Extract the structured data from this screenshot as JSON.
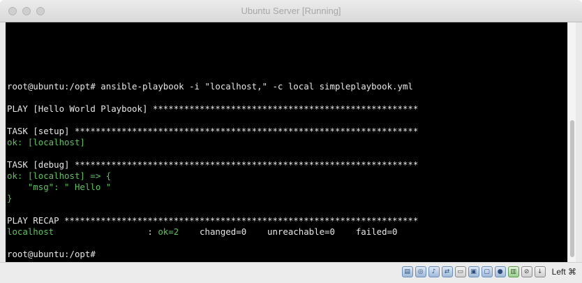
{
  "window": {
    "title": "Ubuntu Server [Running]"
  },
  "terminal": {
    "lines": [
      {
        "segments": [
          {
            "text": "root@ubuntu:/opt# ansible-playbook -i \"localhost,\" -c local simpleplaybook.yml",
            "color": "white"
          }
        ]
      },
      {
        "segments": [
          {
            "text": "",
            "color": "white"
          }
        ]
      },
      {
        "segments": [
          {
            "text": "PLAY [Hello World Playbook] ***************************************************",
            "color": "white"
          }
        ]
      },
      {
        "segments": [
          {
            "text": "",
            "color": "white"
          }
        ]
      },
      {
        "segments": [
          {
            "text": "TASK [setup] ******************************************************************",
            "color": "white"
          }
        ]
      },
      {
        "segments": [
          {
            "text": "ok: [localhost]",
            "color": "green"
          }
        ]
      },
      {
        "segments": [
          {
            "text": "",
            "color": "white"
          }
        ]
      },
      {
        "segments": [
          {
            "text": "TASK [debug] ******************************************************************",
            "color": "white"
          }
        ]
      },
      {
        "segments": [
          {
            "text": "ok: [localhost] => {",
            "color": "green"
          }
        ]
      },
      {
        "segments": [
          {
            "text": "    \"msg\": \" Hello \"",
            "color": "green"
          }
        ]
      },
      {
        "segments": [
          {
            "text": "}",
            "color": "green"
          }
        ]
      },
      {
        "segments": [
          {
            "text": "",
            "color": "white"
          }
        ]
      },
      {
        "segments": [
          {
            "text": "PLAY RECAP ********************************************************************",
            "color": "white"
          }
        ]
      },
      {
        "segments": [
          {
            "text": "localhost                  ",
            "color": "green"
          },
          {
            "text": ": ",
            "color": "white"
          },
          {
            "text": "ok=2",
            "color": "green"
          },
          {
            "text": "    changed=0    unreachable=0    failed=0",
            "color": "white"
          }
        ]
      },
      {
        "segments": [
          {
            "text": "",
            "color": "white"
          }
        ]
      },
      {
        "segments": [
          {
            "text": "root@ubuntu:/opt#",
            "color": "white"
          }
        ]
      }
    ]
  },
  "statusbar": {
    "icons": [
      "hard-disk-icon",
      "optical-drive-icon",
      "audio-icon",
      "network-icon",
      "usb-icon",
      "shared-folders-icon",
      "display-icon",
      "video-capture-icon",
      "cpu-icon",
      "mouse-integration-icon",
      "keyboard-capture-icon"
    ],
    "host_key": "Left ⌘"
  },
  "colors": {
    "terminal_bg": "#000000",
    "terminal_text": "#e6e6e6",
    "terminal_green": "#5fbf5f"
  }
}
